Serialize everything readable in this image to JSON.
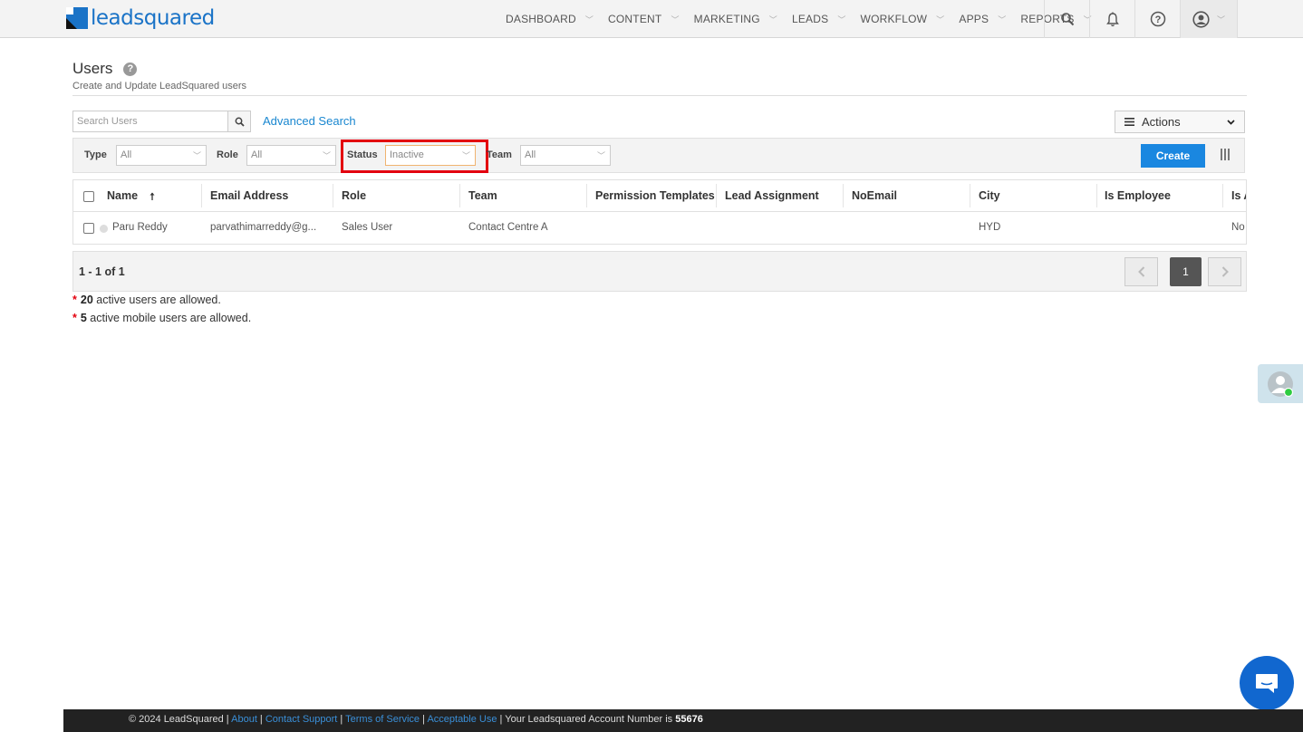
{
  "brand": {
    "name": "leadsquared"
  },
  "nav": {
    "items": [
      {
        "label": "DASHBOARD"
      },
      {
        "label": "CONTENT"
      },
      {
        "label": "MARKETING"
      },
      {
        "label": "LEADS"
      },
      {
        "label": "WORKFLOW"
      },
      {
        "label": "APPS"
      },
      {
        "label": "REPORTS"
      }
    ],
    "icons": [
      "search-icon",
      "bell-icon",
      "help-icon",
      "user-profile-icon"
    ]
  },
  "page": {
    "title": "Users",
    "subtitle": "Create and Update LeadSquared users"
  },
  "toolbar": {
    "search_placeholder": "Search Users",
    "advanced_search": "Advanced Search",
    "actions_label": "Actions"
  },
  "filters": {
    "type_label": "Type",
    "type_value": "All",
    "role_label": "Role",
    "role_value": "All",
    "status_label": "Status",
    "status_value": "Inactive",
    "team_label": "Team",
    "team_value": "All",
    "create_label": "Create"
  },
  "table": {
    "columns": [
      "Name",
      "Email Address",
      "Role",
      "Team",
      "Permission Templates",
      "Lead Assignment",
      "NoEmail",
      "City",
      "Is Employee",
      "Is A"
    ],
    "rows": [
      {
        "name": "Paru Reddy",
        "email": "parvathimarreddy@g...",
        "role": "Sales User",
        "team": "Contact Centre A",
        "city": "HYD",
        "last": "No"
      }
    ]
  },
  "pager": {
    "count": "1 - 1 of 1",
    "current_page": "1"
  },
  "notes": {
    "active_users_count": "20",
    "active_users_text": " active users are allowed.",
    "mobile_users_count": "5",
    "mobile_users_text": " active mobile users are allowed."
  },
  "footer": {
    "copyright": "© 2024 LeadSquared",
    "about": "About",
    "contact": "Contact Support",
    "terms": "Terms of Service",
    "acceptable": "Acceptable Use",
    "account_label": "Your Leadsquared Account Number is",
    "account_number": "55676"
  },
  "colors": {
    "brand_blue": "#1a73c7",
    "accent": "#1a87e0",
    "highlight": "#e3000f"
  }
}
